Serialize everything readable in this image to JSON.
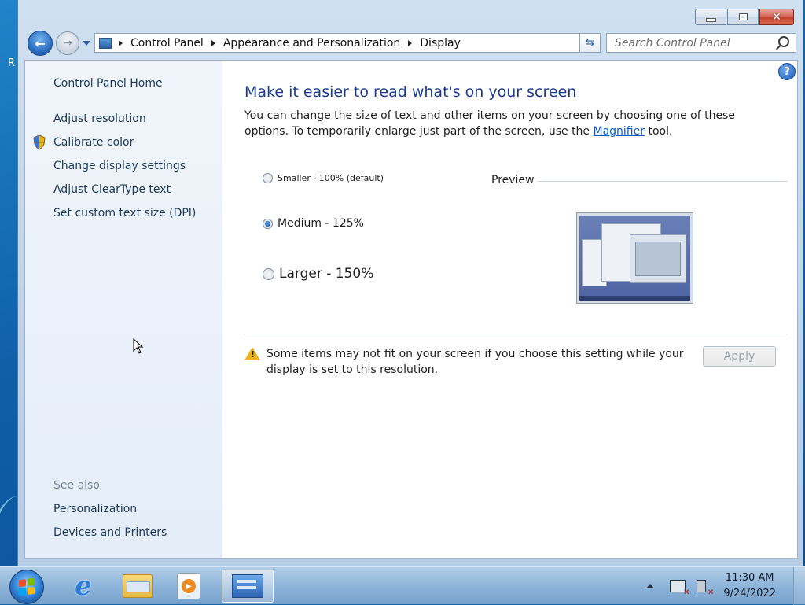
{
  "desktop": {
    "label": "R"
  },
  "window": {
    "title_buttons": {
      "minimize": "minimize",
      "maximize": "maximize",
      "close": "✕"
    }
  },
  "address": {
    "breadcrumbs": [
      "Control Panel",
      "Appearance and Personalization",
      "Display"
    ],
    "search_placeholder": "Search Control Panel"
  },
  "sidebar": {
    "home": "Control Panel Home",
    "links": [
      "Adjust resolution",
      "Calibrate color",
      "Change display settings",
      "Adjust ClearType text",
      "Set custom text size (DPI)"
    ],
    "see_also_heading": "See also",
    "see_also": [
      "Personalization",
      "Devices and Printers"
    ]
  },
  "main": {
    "title": "Make it easier to read what's on your screen",
    "intro_before": "You can change the size of text and other items on your screen by choosing one of these options. To temporarily enlarge just part of the screen, use the ",
    "intro_link": "Magnifier",
    "intro_after": " tool.",
    "options": [
      {
        "label": "Smaller - 100% (default)",
        "checked": false
      },
      {
        "label": "Medium - 125%",
        "checked": true
      },
      {
        "label": "Larger - 150%",
        "checked": false
      }
    ],
    "preview_label": "Preview",
    "warning": "Some items may not fit on your screen if you choose this setting while your display is set to this resolution.",
    "apply_label": "Apply",
    "help": "?"
  },
  "taskbar": {
    "clock_time": "11:30 AM",
    "clock_date": "9/24/2022",
    "pinned": [
      "internet-explorer-icon",
      "windows-explorer-icon",
      "media-player-icon",
      "control-panel-icon"
    ]
  },
  "colors": {
    "title_blue": "#1b3b8f",
    "link_blue": "#0b59c7",
    "sidebar_text": "#1e3a5a",
    "warning_yellow": "#e9b41f"
  }
}
